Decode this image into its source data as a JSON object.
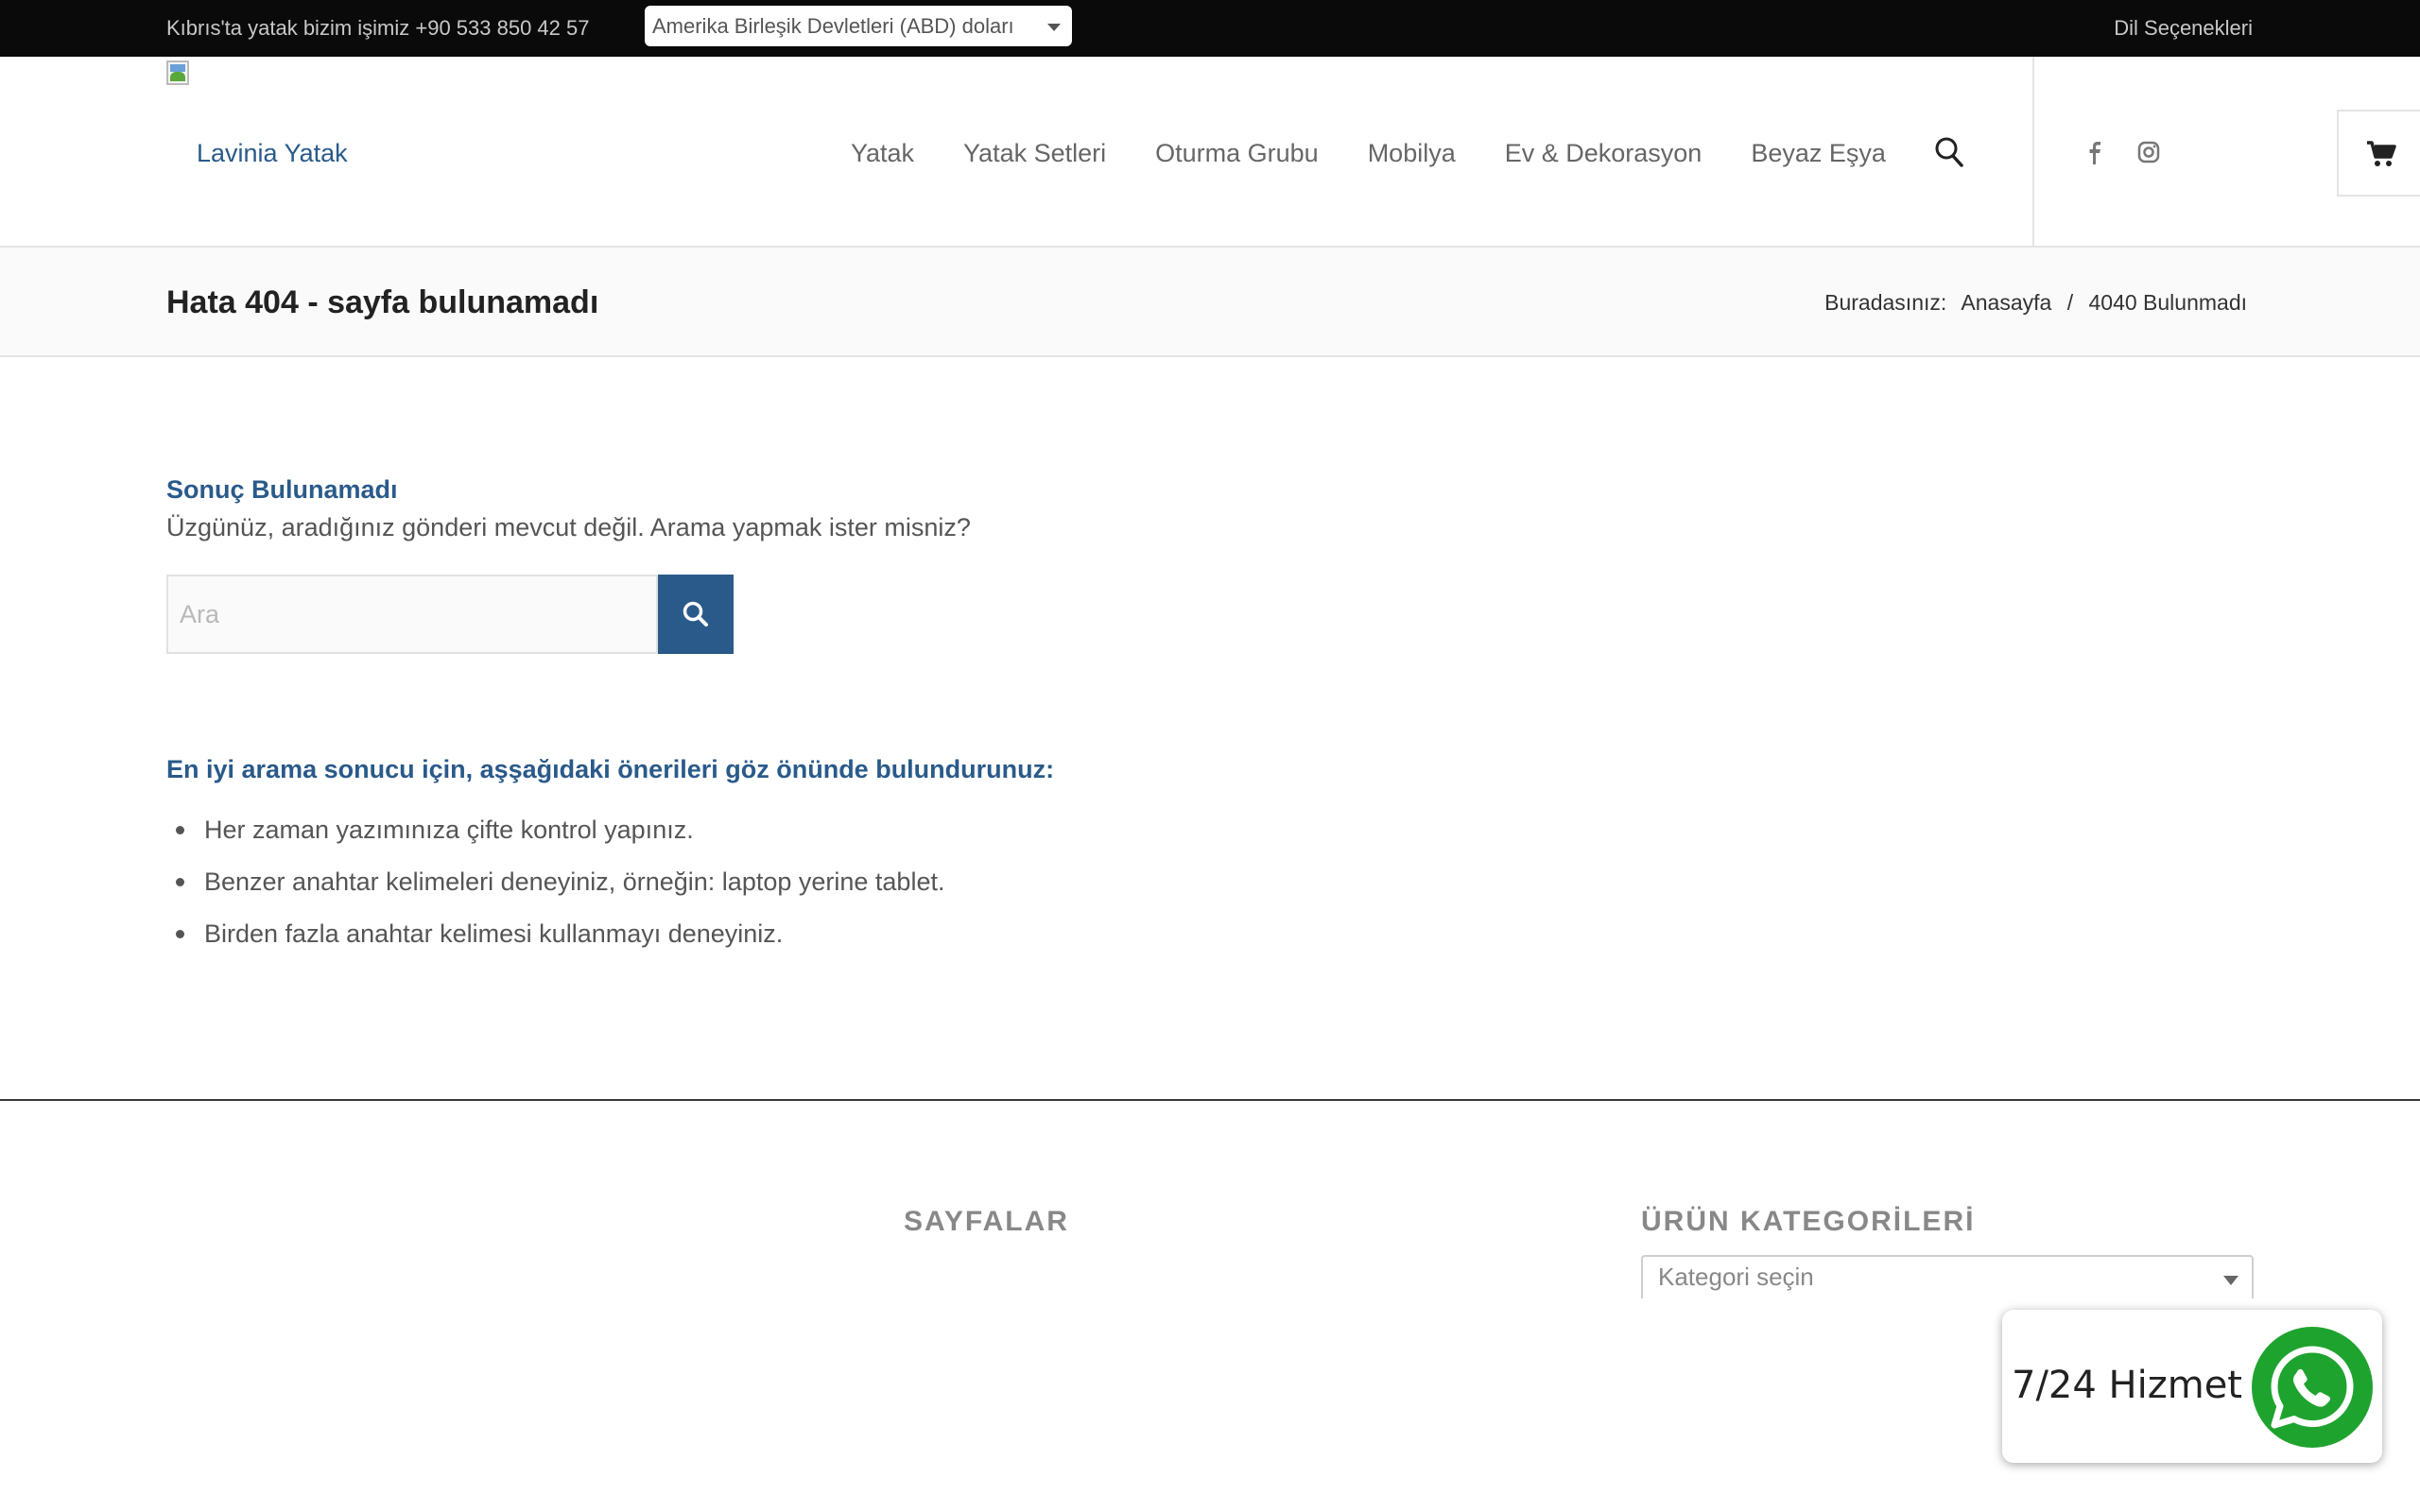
{
  "topbar": {
    "phone_text": "Kıbrıs'ta yatak bizim işimiz +90 533 850 42 57",
    "currency_selected": "Amerika Birleşik Devletleri (ABD) doları",
    "language_label": "Dil Seçenekleri"
  },
  "header": {
    "logo_text": "Lavinia Yatak",
    "nav": [
      {
        "label": "Yatak"
      },
      {
        "label": "Yatak Setleri"
      },
      {
        "label": "Oturma Grubu"
      },
      {
        "label": "Mobilya"
      },
      {
        "label": "Ev & Dekorasyon"
      },
      {
        "label": "Beyaz Eşya"
      }
    ],
    "social": [
      "facebook-icon",
      "instagram-icon"
    ]
  },
  "titlebar": {
    "title": "Hata 404 - sayfa bulunamadı",
    "breadcrumb_prefix": "Buradasınız:",
    "breadcrumb_home": "Anasayfa",
    "breadcrumb_sep": "/",
    "breadcrumb_current": "4040 Bulunmadı"
  },
  "main": {
    "heading": "Sonuç Bulunamadı",
    "message": "Üzgünüz, aradığınız gönderi mevcut değil. Arama yapmak ister misniz?",
    "search_placeholder": "Ara",
    "tips_heading": "En iyi arama sonucu için, aşşağıdaki önerileri göz önünde bulundurunuz:",
    "tips": [
      "Her zaman yazımınıza çifte kontrol yapınız.",
      "Benzer anahtar kelimeleri deneyiniz, örneğin: laptop yerine tablet.",
      "Birden fazla anahtar kelimesi kullanmayı deneyiniz."
    ]
  },
  "footer": {
    "pages_heading": "SAYFALAR",
    "categories_heading": "ÜRÜN KATEGORİLERİ",
    "category_select": "Kategori seçin"
  },
  "whatsapp": {
    "label": "7/24 Hizmet",
    "color": "#1fa32f"
  },
  "colors": {
    "accent": "#2a5a8a",
    "topbar_bg": "#0a0a0a"
  }
}
